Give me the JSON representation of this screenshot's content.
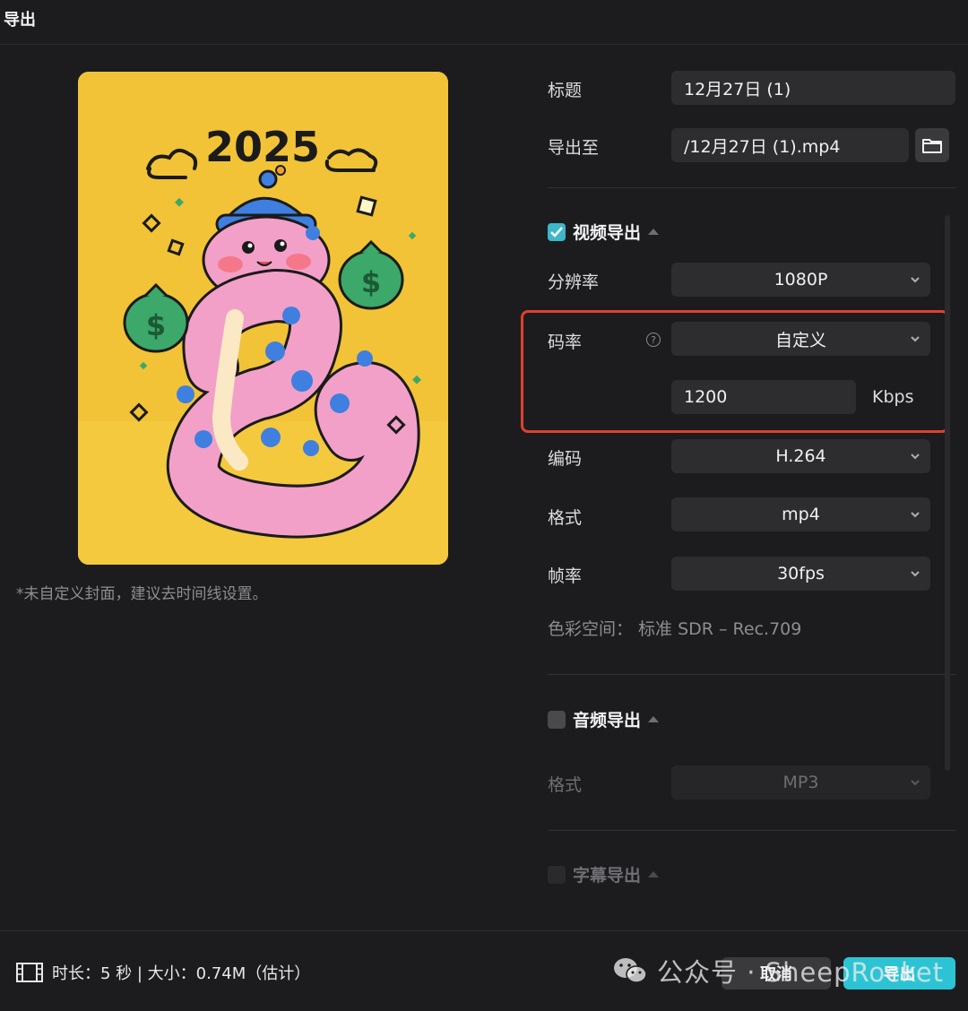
{
  "window": {
    "title": "导出"
  },
  "cover": {
    "note": "*未自定义封面，建议去时间线设置。",
    "image_label": "2025"
  },
  "form": {
    "title_label": "标题",
    "title_value": "12月27日 (1)",
    "export_to_label": "导出至",
    "export_to_value": "/12月27日 (1).mp4",
    "folder_icon": "folder-icon"
  },
  "video": {
    "section_label": "视频导出",
    "checked": true,
    "resolution_label": "分辨率",
    "resolution_value": "1080P",
    "bitrate_label": "码率",
    "bitrate_value": "自定义",
    "bitrate_custom_value": "1200",
    "bitrate_unit": "Kbps",
    "codec_label": "编码",
    "codec_value": "H.264",
    "format_label": "格式",
    "format_value": "mp4",
    "framerate_label": "帧率",
    "framerate_value": "30fps",
    "colorspace": "色彩空间：  标准 SDR – Rec.709"
  },
  "audio": {
    "section_label": "音频导出",
    "checked": false,
    "format_label": "格式",
    "format_value": "MP3"
  },
  "subtitle": {
    "section_label": "字幕导出",
    "checked": false
  },
  "footer": {
    "info": "时长：5 秒 | 大小：0.74M（估计）",
    "cancel_label": "取消",
    "export_label": "导出"
  },
  "watermark": {
    "text": "公众号 · SheepRocket"
  },
  "colors": {
    "accent": "#2cc4d4",
    "highlight": "#e0402e",
    "background": "#1c1c1e"
  }
}
